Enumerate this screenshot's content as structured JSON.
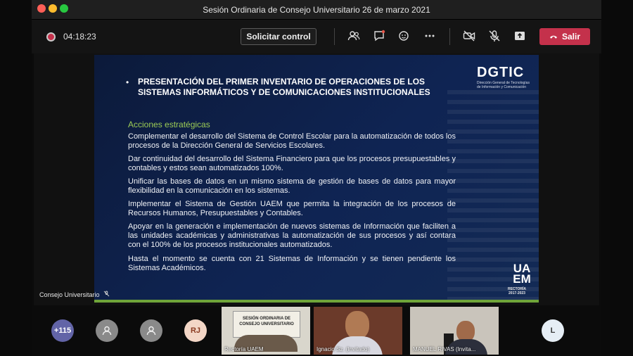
{
  "window": {
    "title": "Sesión Ordinaria de Consejo Universitario 26 de marzo 2021"
  },
  "toolbar": {
    "timer": "04:18:23",
    "request_control_label": "Solicitar control",
    "leave_label": "Salir",
    "icons": [
      "participants-icon",
      "chat-icon",
      "reactions-icon",
      "more-options-icon",
      "camera-off-icon",
      "mic-off-icon",
      "share-icon"
    ]
  },
  "slide": {
    "bullet": "•",
    "heading": "PRESENTACIÓN DEL PRIMER INVENTARIO DE OPERACIONES DE LOS SISTEMAS INFORMÁTICOS Y DE COMUNICACIONES INSTITUCIONALES",
    "logo": "DGTIC",
    "logo_sub": "Dirección General de Tecnologías de Información y Comunicación",
    "section_title": "Acciones estratégicas",
    "paragraphs": [
      "Complementar el desarrollo del Sistema de Control Escolar para la automatización de todos los procesos de la Dirección General de Servicios Escolares.",
      "Dar continuidad del desarrollo del Sistema Financiero para que los procesos presupuestables y contables y estos sean automatizados 100%.",
      "Unificar las bases de datos en un mismo sistema de gestión de bases de datos para mayor flexibilidad en la comunicación en los sistemas.",
      "Implementar el Sistema de Gestión UAEM que permita la integración de los procesos de Recursos Humanos, Presupuestables y Contables.",
      "Apoyar en la generación e implementación de nuevos sistemas de Información que faciliten a las unidades académicas y administrativas la automatización de sus procesos y así contara con el 100% de los procesos institucionales automatizados.",
      "Hasta el momento se cuenta con 21 Sistemas de Información y se tienen pendiente los Sistemas Académicos."
    ],
    "uaem_logo": "UA EM",
    "uaem_sub": "RECTORÍA 2017-2023"
  },
  "stage": {
    "presenter_name": "Consejo Universitario"
  },
  "participants": {
    "overflow_count": "+115",
    "rj_initials": "RJ",
    "l_initials": "L",
    "tiles": [
      {
        "name": "Rectoría UAEM",
        "banner": "SESIÓN ORDINARIA DE CONSEJO UNIVERSITARIO"
      },
      {
        "name": "Ignacio Sz. (Invitado)"
      },
      {
        "name": "MANUEL RIVAS (Invita..."
      }
    ]
  },
  "colors": {
    "leave": "#c4314b",
    "accent_green": "#9ccc55",
    "slide_bg": "#0f2453",
    "avatar_more": "#6264a7"
  }
}
